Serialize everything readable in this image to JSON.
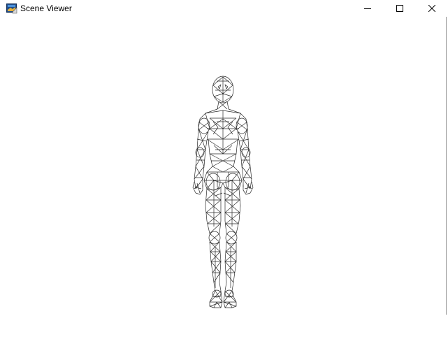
{
  "window": {
    "title": "Scene Viewer",
    "app_icon": "scene-viewer-app-icon",
    "controls": {
      "minimize_icon": "minimize-icon",
      "maximize_icon": "maximize-icon",
      "close_icon": "close-icon"
    }
  },
  "scene": {
    "model": "wireframe-human-figure",
    "background_color": "#ffffff",
    "wire_color": "#2a2a2a"
  }
}
